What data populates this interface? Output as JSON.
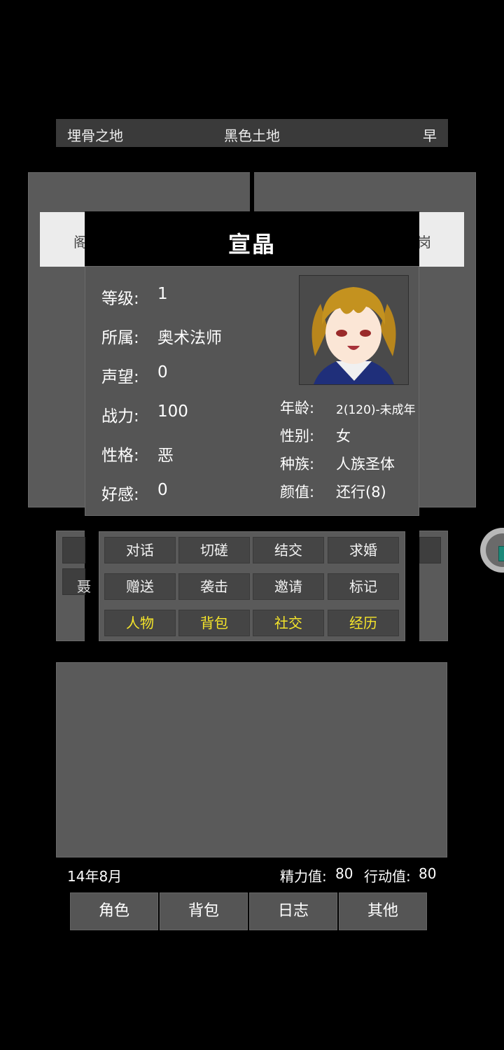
{
  "topbar": {
    "location": "埋骨之地",
    "terrain": "黑色土地",
    "time": "早"
  },
  "background": {
    "left_tab_partial": "阁",
    "right_tab_partial": "岗",
    "left_button_partial": "聂"
  },
  "character": {
    "name": "宣晶",
    "fields": [
      {
        "label": "等级:",
        "value": "1"
      },
      {
        "label": "所属:",
        "value": "奥术法师"
      },
      {
        "label": "声望:",
        "value": "0"
      },
      {
        "label": "战力:",
        "value": "100"
      },
      {
        "label": "性格:",
        "value": "恶"
      },
      {
        "label": "好感:",
        "value": "0"
      }
    ],
    "side_fields": [
      {
        "label": "年龄:",
        "value": "2(120)-未成年"
      },
      {
        "label": "性别:",
        "value": "女"
      },
      {
        "label": "种族:",
        "value": "人族圣体"
      },
      {
        "label": "颜值:",
        "value": "还行(8)"
      }
    ],
    "portrait": "anime-girl-portrait"
  },
  "actions": {
    "row1": [
      "对话",
      "切磋",
      "结交",
      "求婚"
    ],
    "row2": [
      "赠送",
      "袭击",
      "邀请",
      "标记"
    ],
    "row3": [
      "人物",
      "背包",
      "社交",
      "经历"
    ],
    "highlight_color": "#f5e52a"
  },
  "status": {
    "date": "14年8月",
    "energy_label": "精力值:",
    "energy_value": "80",
    "action_label": "行动值:",
    "action_value": "80"
  },
  "nav": [
    "角色",
    "背包",
    "日志",
    "其他"
  ]
}
